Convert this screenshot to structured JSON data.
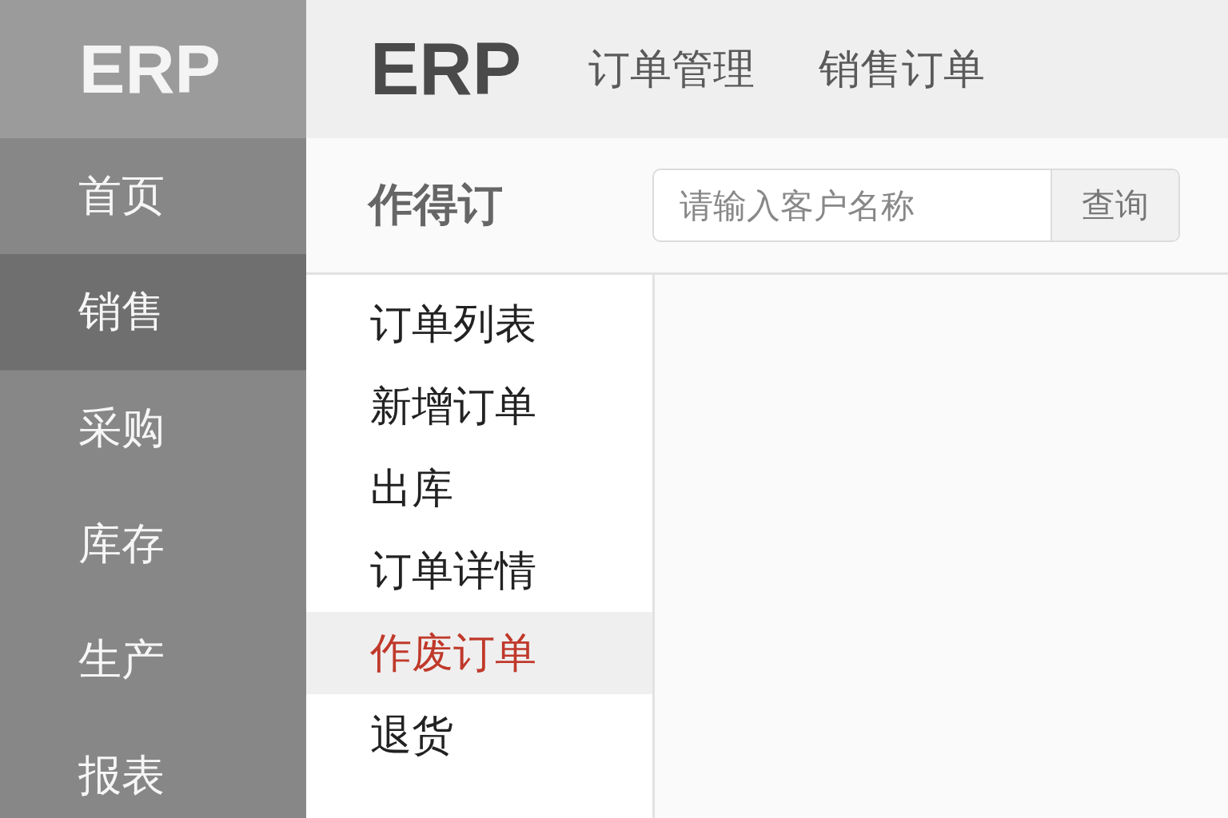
{
  "sidebar": {
    "logo": "ERP",
    "items": [
      {
        "label": "首页",
        "selected": false
      },
      {
        "label": "销售",
        "selected": true
      },
      {
        "label": "采购",
        "selected": false
      },
      {
        "label": "库存",
        "selected": false
      },
      {
        "label": "生产",
        "selected": false
      },
      {
        "label": "报表",
        "selected": false
      }
    ]
  },
  "header": {
    "logo": "ERP",
    "breadcrumbs": [
      "订单管理",
      "销售订单"
    ]
  },
  "toolbar": {
    "title": "作得订",
    "search": {
      "placeholder": "请输入客户名称",
      "button": "查询"
    }
  },
  "submenu": {
    "items": [
      {
        "label": "订单列表",
        "selected": false
      },
      {
        "label": "新增订单",
        "selected": false
      },
      {
        "label": "出库",
        "selected": false
      },
      {
        "label": "订单详情",
        "selected": false
      },
      {
        "label": "作废订单",
        "selected": true
      },
      {
        "label": "退货",
        "selected": false
      }
    ]
  }
}
